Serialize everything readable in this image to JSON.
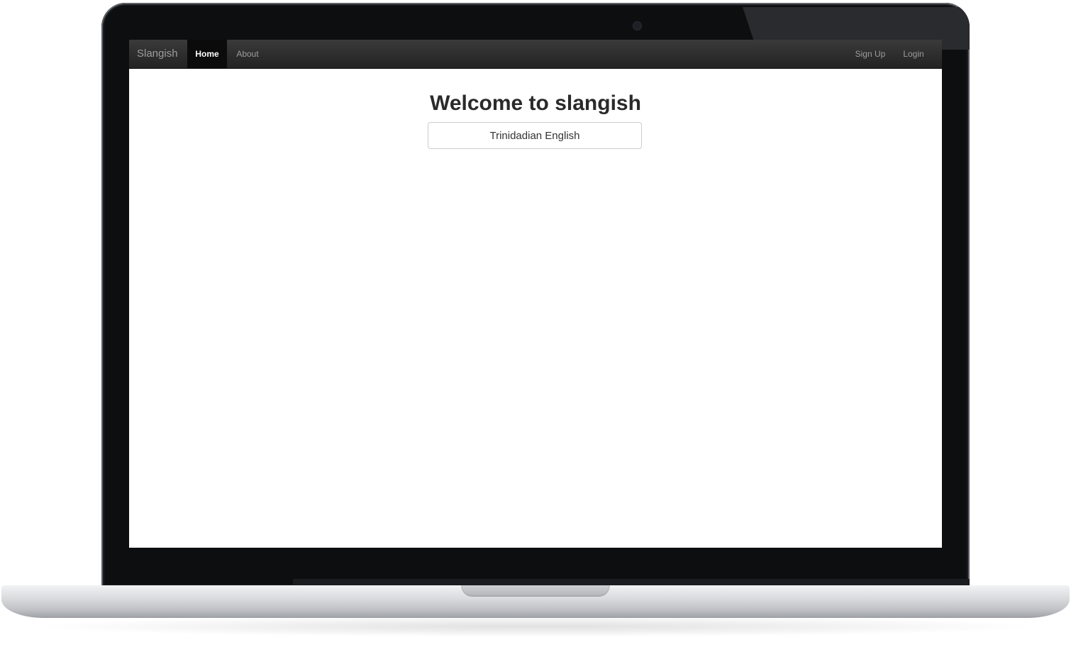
{
  "navbar": {
    "brand": "Slangish",
    "links": {
      "home": "Home",
      "about": "About",
      "signup": "Sign Up",
      "login": "Login"
    },
    "active": "home"
  },
  "main": {
    "title": "Welcome to slangish",
    "language_select": {
      "value": "Trinidadian English"
    }
  },
  "colors": {
    "navbar_bg": "#2b2b2b",
    "active_nav_bg": "#0b0b0b",
    "nav_text": "#9d9d9d"
  }
}
